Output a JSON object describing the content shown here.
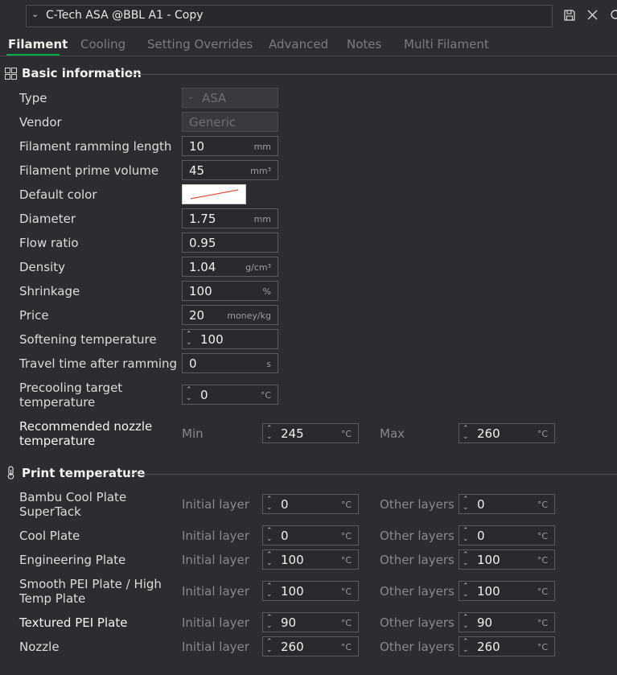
{
  "header": {
    "preset_name": "C-Tech ASA @BBL A1 - Copy"
  },
  "tabs": [
    {
      "label": "Filament"
    },
    {
      "label": "Cooling"
    },
    {
      "label": "Setting Overrides"
    },
    {
      "label": "Advanced"
    },
    {
      "label": "Notes"
    },
    {
      "label": "Multi Filament"
    }
  ],
  "basic": {
    "title": "Basic information",
    "type": {
      "label": "Type",
      "value": "ASA"
    },
    "vendor": {
      "label": "Vendor",
      "value": "Generic"
    },
    "ramming_length": {
      "label": "Filament ramming length",
      "value": "10",
      "unit": "mm"
    },
    "prime_volume": {
      "label": "Filament prime volume",
      "value": "45",
      "unit": "mm³"
    },
    "default_color": {
      "label": "Default color"
    },
    "diameter": {
      "label": "Diameter",
      "value": "1.75",
      "unit": "mm"
    },
    "flow_ratio": {
      "label": "Flow ratio",
      "value": "0.95"
    },
    "density": {
      "label": "Density",
      "value": "1.04",
      "unit": "g/cm³"
    },
    "shrinkage": {
      "label": "Shrinkage",
      "value": "100",
      "unit": "%"
    },
    "price": {
      "label": "Price",
      "value": "20",
      "unit": "money/kg"
    },
    "softening_temp": {
      "label": "Softening temperature",
      "value": "100"
    },
    "travel_time": {
      "label": "Travel time after ramming",
      "value": "0",
      "unit": "s"
    },
    "precooling": {
      "label_line1": "Precooling target",
      "label_line2": "temperature",
      "value": "0",
      "unit": "°C"
    },
    "nozzle_temp": {
      "label_line1": "Recommended nozzle",
      "label_line2": "temperature",
      "min_label": "Min",
      "min_value": "245",
      "max_label": "Max",
      "max_value": "260",
      "unit": "°C"
    }
  },
  "print_temp": {
    "title": "Print temperature",
    "initial_label": "Initial layer",
    "other_label": "Other layers",
    "unit": "°C",
    "rows": [
      {
        "line1": "Bambu Cool Plate",
        "line2": "SuperTack",
        "initial": "0",
        "other": "0"
      },
      {
        "line1": "Cool Plate",
        "line2": "",
        "initial": "0",
        "other": "0"
      },
      {
        "line1": "Engineering Plate",
        "line2": "",
        "initial": "100",
        "other": "100"
      },
      {
        "line1": "Smooth PEI Plate / High",
        "line2": "Temp Plate",
        "initial": "100",
        "other": "100"
      },
      {
        "line1": "Textured PEI Plate",
        "line2": "",
        "initial": "90",
        "other": "90"
      },
      {
        "line1": "Nozzle",
        "line2": "",
        "initial": "260",
        "other": "260"
      }
    ]
  }
}
